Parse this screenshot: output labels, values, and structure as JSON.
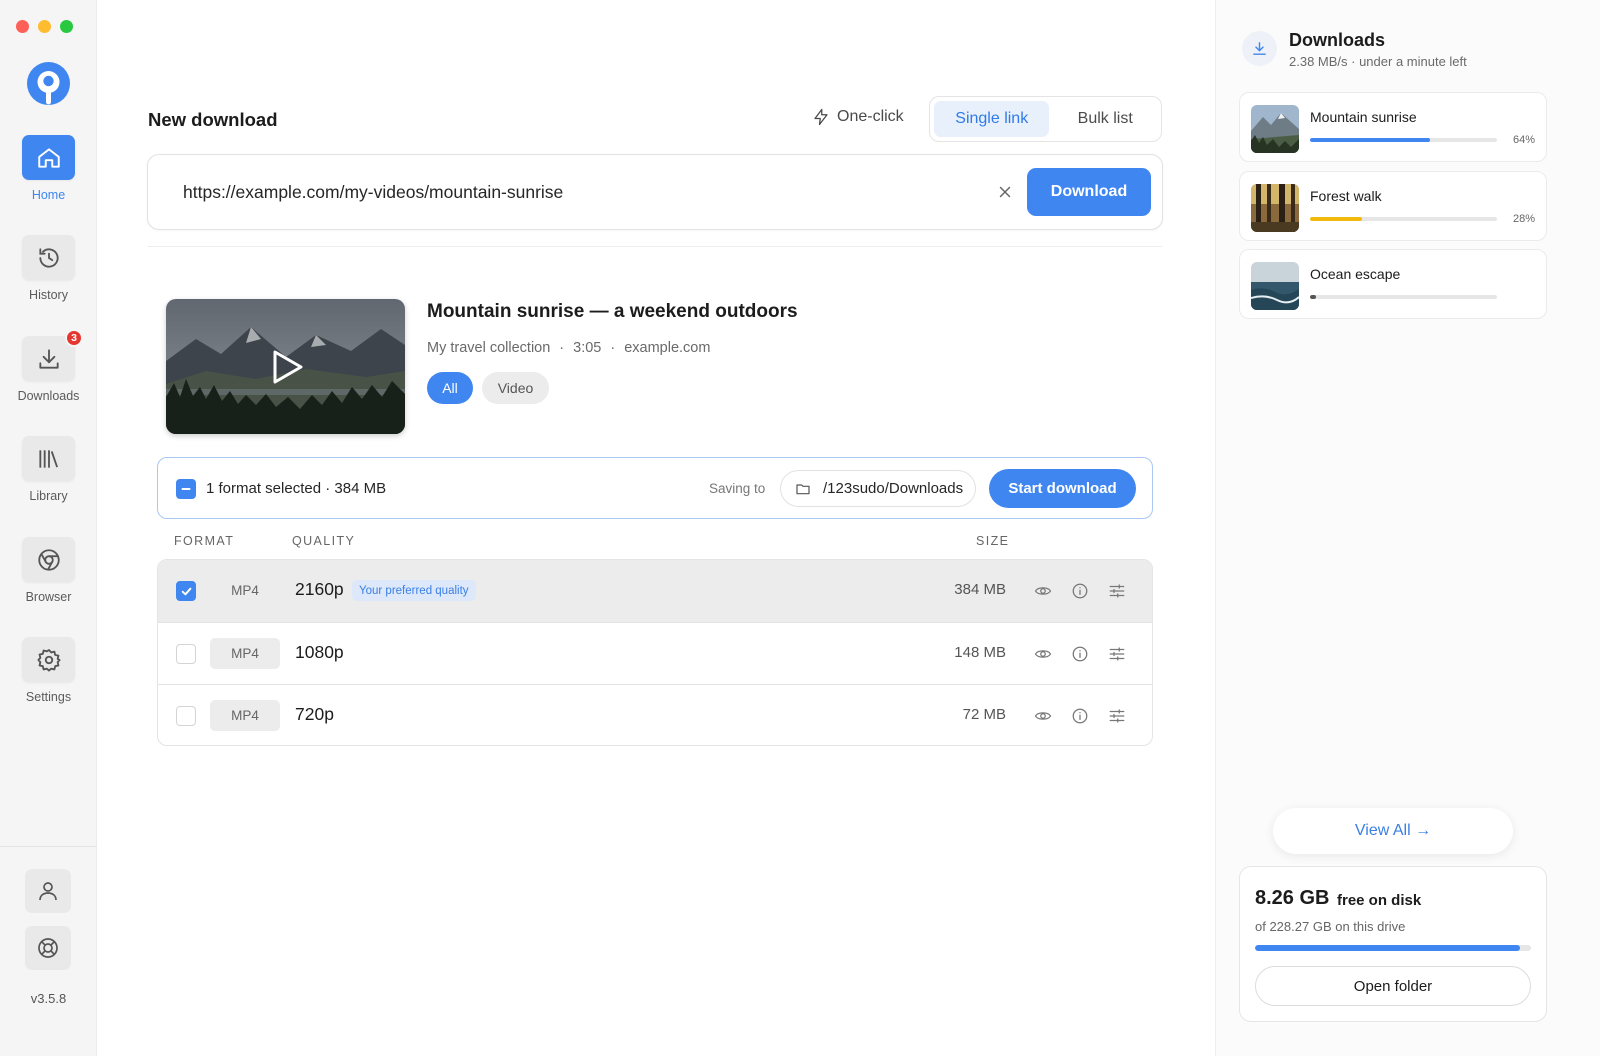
{
  "sidebar": {
    "items": [
      {
        "label": "Home",
        "icon": "home-icon",
        "active": true
      },
      {
        "label": "History",
        "icon": "history-icon"
      },
      {
        "label": "Downloads",
        "icon": "download-icon",
        "badge": "3"
      },
      {
        "label": "Library",
        "icon": "library-icon"
      },
      {
        "label": "Browser",
        "icon": "browser-icon"
      },
      {
        "label": "Settings",
        "icon": "gear-icon"
      }
    ],
    "version": "v3.5.8"
  },
  "header": {
    "title": "New download",
    "one_click": "One-click",
    "mode_tabs": [
      "Single link",
      "Bulk list"
    ]
  },
  "url_bar": {
    "value": "https://example.com/my-videos/mountain-sunrise",
    "download_label": "Download"
  },
  "video": {
    "title": "Mountain sunrise — a weekend outdoors",
    "collection": "My travel collection",
    "duration": "3:05",
    "source": "example.com",
    "filters": [
      "All",
      "Video"
    ]
  },
  "selection": {
    "summary": "1 format selected · 384 MB",
    "saving_label": "Saving to",
    "path": "/123sudo/Downloads",
    "start_label": "Start download"
  },
  "table": {
    "headers": [
      "FORMAT",
      "QUALITY",
      "SIZE"
    ],
    "rows": [
      {
        "format": "MP4",
        "quality": "2160p",
        "tag": "Your preferred quality",
        "size": "384 MB",
        "checked": true
      },
      {
        "format": "MP4",
        "quality": "1080p",
        "size": "148 MB",
        "checked": false
      },
      {
        "format": "MP4",
        "quality": "720p",
        "size": "72 MB",
        "checked": false
      }
    ]
  },
  "downloads_panel": {
    "title": "Downloads",
    "subtitle": "2.38 MB/s · under a minute left",
    "items": [
      {
        "name": "Mountain sunrise",
        "progress": 0.64,
        "percent": "64%",
        "color": "#3f86f0"
      },
      {
        "name": "Forest walk",
        "progress": 0.28,
        "percent": "28%",
        "color": "#f2b90c"
      },
      {
        "name": "Ocean escape",
        "progress": 0.03,
        "percent": "",
        "color": "#555555"
      }
    ],
    "view_all": "View All →"
  },
  "disk": {
    "free": "8.26 GB",
    "free_label": "free on disk",
    "of_total": "of 228.27 GB on this drive",
    "usage_fraction": 0.96,
    "open_folder": "Open folder"
  },
  "colors": {
    "accent": "#3f86f0",
    "badge": "#e5372f"
  }
}
